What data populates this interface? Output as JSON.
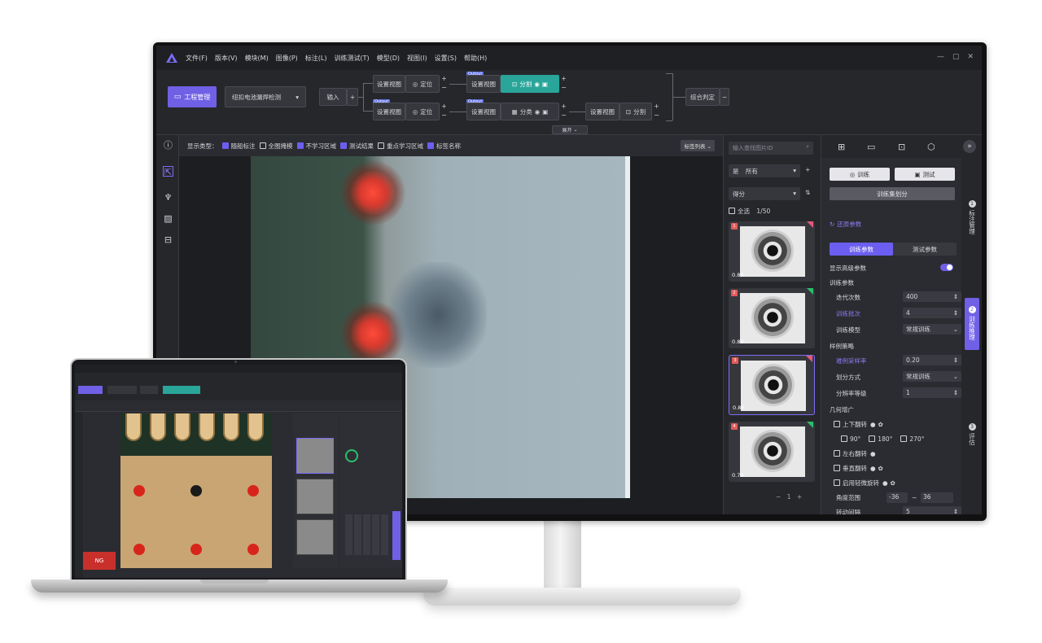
{
  "menu": [
    "文件(F)",
    "版本(V)",
    "模块(M)",
    "图像(P)",
    "标注(L)",
    "训练测试(T)",
    "模型(D)",
    "视图(I)",
    "设置(S)",
    "帮助(H)"
  ],
  "window_controls": [
    "—",
    "▢",
    "✕"
  ],
  "workflow": {
    "project_button": "工程管理",
    "project_select": "纽扣电池漏焊检测",
    "input_label": "输入",
    "set_view": "设置视图",
    "locate": "定位",
    "split": "分割",
    "classify": "分类",
    "output_tag": "Output",
    "judge": "综合判定",
    "expand": "展开"
  },
  "display_bar": {
    "label": "显示类型：",
    "options": [
      {
        "label": "随船标注",
        "checked": true
      },
      {
        "label": "全图掩模",
        "checked": false
      },
      {
        "label": "不学习区域",
        "checked": true
      },
      {
        "label": "测试结果",
        "checked": true
      },
      {
        "label": "重点学习区域",
        "checked": false
      },
      {
        "label": "标签名称",
        "checked": true
      }
    ],
    "label_list": "标签列表"
  },
  "thumbs": {
    "search_placeholder": "输入查找图片ID",
    "filter_prefix": "是",
    "filter_value": "所有",
    "sort_value": "得分",
    "select_all": "全选",
    "count": "1/50",
    "items": [
      {
        "index": "1",
        "score": "0.89"
      },
      {
        "index": "2",
        "score": "0.89"
      },
      {
        "index": "3",
        "score": "0.86"
      },
      {
        "index": "4",
        "score": "0.79"
      }
    ],
    "page": "1"
  },
  "right_panel": {
    "train_btn": "训练",
    "test_btn": "测试",
    "split_btn": "训练集划分",
    "restore": "还原参数",
    "tab_train": "训练参数",
    "tab_test": "测试参数",
    "show_advanced": "显示高级参数",
    "train_params": "训练参数",
    "iterations_label": "迭代次数",
    "iterations_value": "400",
    "batch_label": "训练批次",
    "batch_value": "4",
    "mode_label": "训练模型",
    "mode_value": "常规训练",
    "sample_strategy": "样例策略",
    "hard_rate_label": "难例采样率",
    "hard_rate_value": "0.20",
    "split_mode_label": "划分方式",
    "split_mode_value": "常规训练",
    "res_label": "分辨率等级",
    "res_value": "1",
    "geo_aug": "几何增广",
    "flip_ud": "上下翻转",
    "rot90": "90°",
    "rot180": "180°",
    "rot270": "270°",
    "flip_lr": "左右翻转",
    "flip_v": "垂直翻转",
    "small_rot": "启用轻微旋转",
    "angle_label": "角度范围",
    "angle_min": "-36",
    "angle_sep": "~",
    "angle_max": "36",
    "rot_interval_label": "转动间隔",
    "rot_interval_value": "5",
    "side_tabs": [
      {
        "num": "1",
        "label": "标注管理"
      },
      {
        "num": "2",
        "label": "训练推理"
      },
      {
        "num": "3",
        "label": "评估"
      }
    ]
  },
  "laptop": {
    "ng_label": "NG"
  }
}
